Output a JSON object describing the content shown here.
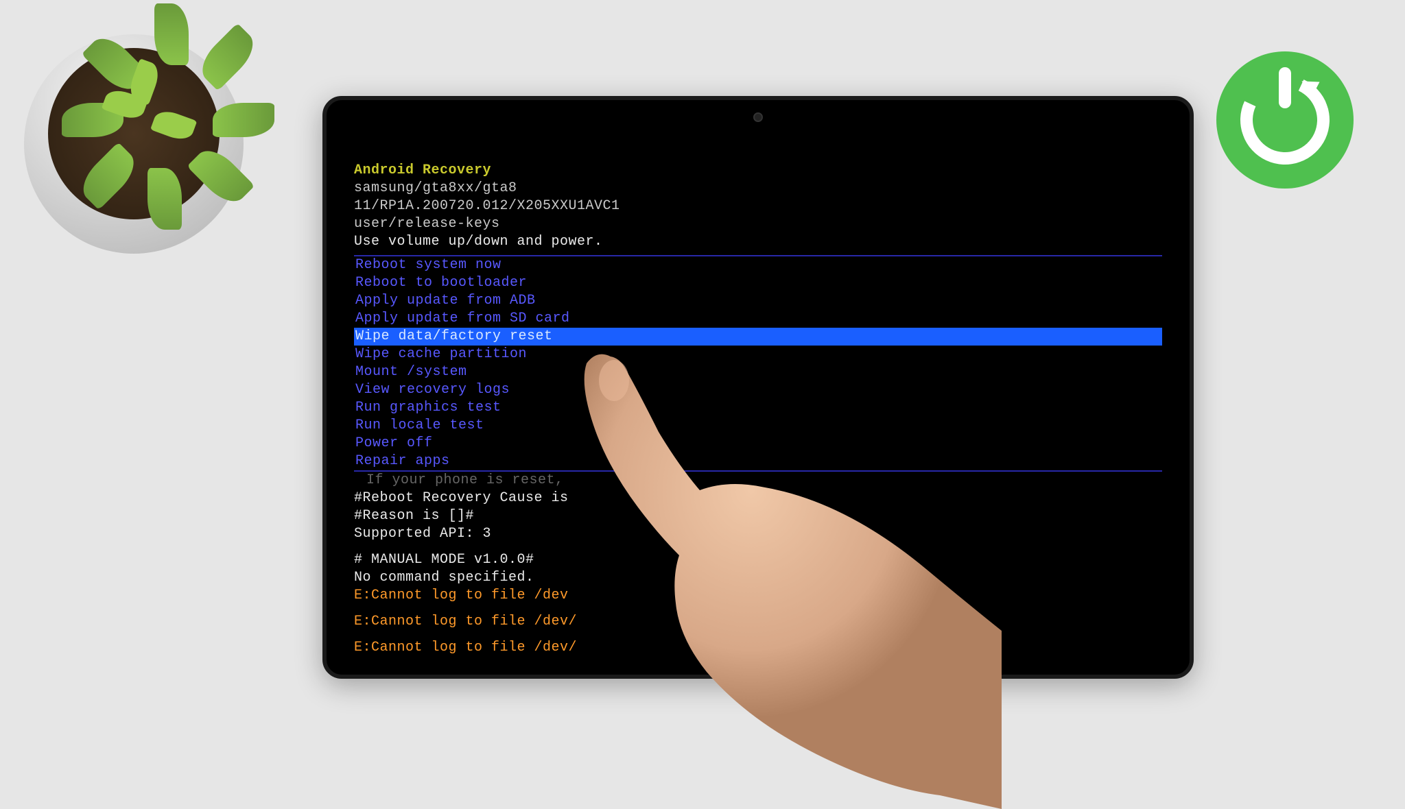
{
  "recovery": {
    "title": "Android Recovery",
    "device": "samsung/gta8xx/gta8",
    "build": "11/RP1A.200720.012/X205XXU1AVC1",
    "keys": "user/release-keys",
    "hint": "Use volume up/down and power."
  },
  "menu": {
    "items": [
      "Reboot system now",
      "Reboot to bootloader",
      "Apply update from ADB",
      "Apply update from SD card",
      "Wipe data/factory reset",
      "Wipe cache partition",
      "Mount /system",
      "View recovery logs",
      "Run graphics test",
      "Run locale test",
      "Power off",
      "Repair apps"
    ],
    "selectedIndex": 4,
    "note": "If your phone is reset,"
  },
  "log": {
    "line1": "#Reboot Recovery Cause is",
    "line2": "#Reason is []#",
    "line3": "Supported API: 3",
    "line4": "# MANUAL MODE v1.0.0#",
    "line5": "No command specified.",
    "err1": "E:Cannot log to file /dev",
    "err2": "E:Cannot log to file /dev/",
    "err3": "E:Cannot log to file /dev/"
  }
}
